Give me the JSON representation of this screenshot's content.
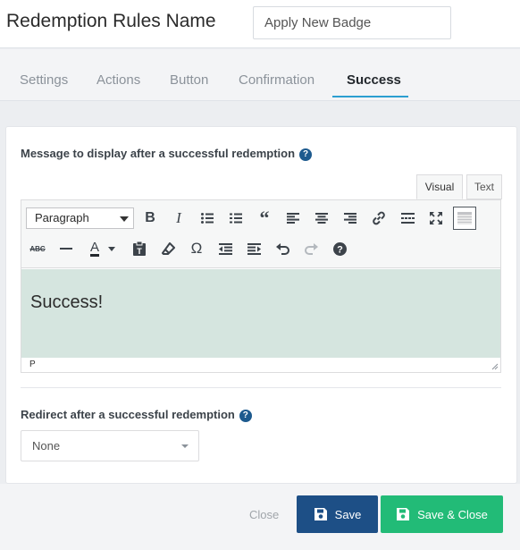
{
  "header": {
    "title": "Redemption Rules Name",
    "name_value": "Apply New Badge"
  },
  "tabs": [
    {
      "label": "Settings",
      "active": false
    },
    {
      "label": "Actions",
      "active": false
    },
    {
      "label": "Button",
      "active": false
    },
    {
      "label": "Confirmation",
      "active": false
    },
    {
      "label": "Success",
      "active": true
    }
  ],
  "message_section": {
    "label": "Message to display after a successful redemption",
    "help_icon": "?"
  },
  "editor": {
    "mode_tabs": {
      "visual": "Visual",
      "text": "Text"
    },
    "format_select": "Paragraph",
    "content": "Success!",
    "status_path": "P",
    "text_color_letter": "A",
    "toolbar_icons": [
      "bold-icon",
      "italic-icon",
      "bullet-list-icon",
      "numbered-list-icon",
      "blockquote-icon",
      "align-left-icon",
      "align-center-icon",
      "align-right-icon",
      "link-icon",
      "read-more-icon",
      "fullscreen-icon",
      "toolbar-toggle-icon",
      "strikethrough-icon",
      "horizontal-line-icon",
      "text-color-icon",
      "paste-text-icon",
      "clear-formatting-icon",
      "special-character-icon",
      "outdent-icon",
      "indent-icon",
      "undo-icon",
      "redo-icon",
      "help-icon"
    ],
    "content_bg": "#d5e5df"
  },
  "redirect_section": {
    "label": "Redirect after a successful redemption",
    "help_icon": "?",
    "selected": "None"
  },
  "footer": {
    "close_label": "Close",
    "save_label": "Save",
    "save_close_label": "Save & Close",
    "save_color": "#1d4f86",
    "save_close_color": "#22bb77"
  }
}
